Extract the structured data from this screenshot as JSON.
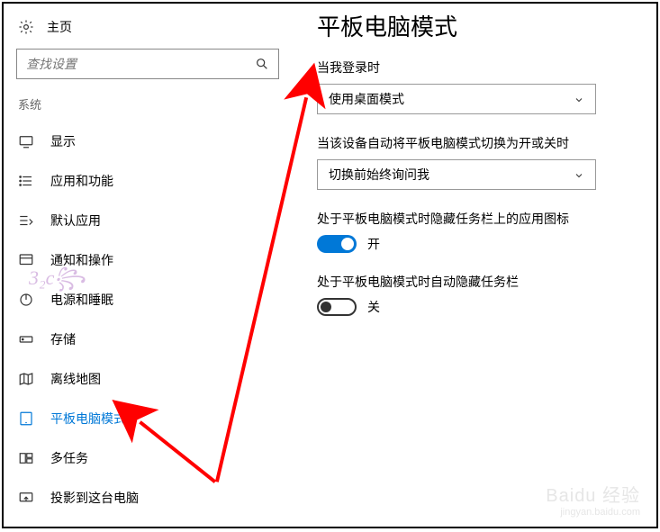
{
  "sidebar": {
    "home_label": "主页",
    "search_placeholder": "查找设置",
    "group_label": "系统",
    "items": [
      {
        "label": "显示"
      },
      {
        "label": "应用和功能"
      },
      {
        "label": "默认应用"
      },
      {
        "label": "通知和操作"
      },
      {
        "label": "电源和睡眠"
      },
      {
        "label": "存储"
      },
      {
        "label": "离线地图"
      },
      {
        "label": "平板电脑模式"
      },
      {
        "label": "多任务"
      },
      {
        "label": "投影到这台电脑"
      }
    ]
  },
  "content": {
    "title": "平板电脑模式",
    "field1_label": "当我登录时",
    "dropdown1_value": "使用桌面模式",
    "field2_label": "当该设备自动将平板电脑模式切换为开或关时",
    "dropdown2_value": "切换前始终询问我",
    "toggle1_label": "处于平板电脑模式时隐藏任务栏上的应用图标",
    "toggle1_state": "开",
    "toggle2_label": "处于平板电脑模式时自动隐藏任务栏",
    "toggle2_state": "关"
  },
  "watermark": {
    "line1": "Baidu 经验",
    "line2": "jingyan.baidu.com"
  }
}
